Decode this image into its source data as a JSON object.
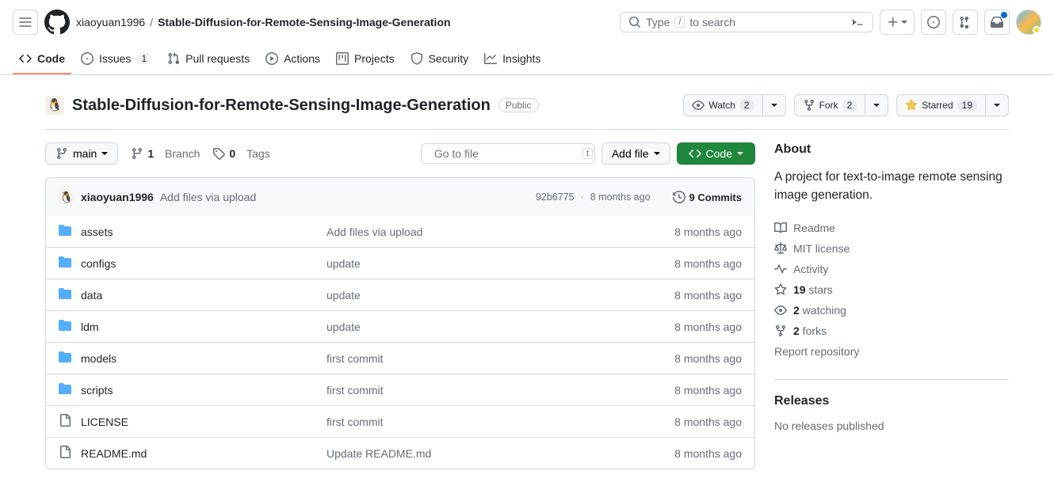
{
  "header": {
    "owner": "xiaoyuan1996",
    "repo": "Stable-Diffusion-for-Remote-Sensing-Image-Generation",
    "searchPlaceholder": "Type / to search",
    "searchPrefix": "Type ",
    "searchSuffix": " to search",
    "slashKey": "/"
  },
  "nav": {
    "code": "Code",
    "issues": "Issues",
    "issuesCount": "1",
    "pulls": "Pull requests",
    "actions": "Actions",
    "projects": "Projects",
    "security": "Security",
    "insights": "Insights"
  },
  "repo": {
    "visibility": "Public",
    "watch": "Watch",
    "watchCount": "2",
    "fork": "Fork",
    "forkCount": "2",
    "starred": "Starred",
    "starCount": "19"
  },
  "toolbar": {
    "branch": "main",
    "branchCount": "1",
    "branchLabel": "Branch",
    "tagCount": "0",
    "tagLabel": "Tags",
    "goToFile": "Go to file",
    "goToFileKey": "t",
    "addFile": "Add file",
    "code": "Code"
  },
  "commit": {
    "author": "xiaoyuan1996",
    "message": "Add files via upload",
    "hash": "92b6775",
    "dotsep": "·",
    "time": "8 months ago",
    "count": "9 Commits"
  },
  "files": [
    {
      "type": "dir",
      "name": "assets",
      "msg": "Add files via upload",
      "time": "8 months ago"
    },
    {
      "type": "dir",
      "name": "configs",
      "msg": "update",
      "time": "8 months ago"
    },
    {
      "type": "dir",
      "name": "data",
      "msg": "update",
      "time": "8 months ago"
    },
    {
      "type": "dir",
      "name": "ldm",
      "msg": "update",
      "time": "8 months ago"
    },
    {
      "type": "dir",
      "name": "models",
      "msg": "first commit",
      "time": "8 months ago"
    },
    {
      "type": "dir",
      "name": "scripts",
      "msg": "first commit",
      "time": "8 months ago"
    },
    {
      "type": "file",
      "name": "LICENSE",
      "msg": "first commit",
      "time": "8 months ago"
    },
    {
      "type": "file",
      "name": "README.md",
      "msg": "Update README.md",
      "time": "8 months ago"
    }
  ],
  "about": {
    "title": "About",
    "desc": "A project for text-to-image remote sensing image generation.",
    "readme": "Readme",
    "license": "MIT license",
    "activity": "Activity",
    "starsCount": "19",
    "starsLabel": " stars",
    "watchCount": "2",
    "watchLabel": " watching",
    "forksCount": "2",
    "forksLabel": " forks",
    "report": "Report repository"
  },
  "releases": {
    "title": "Releases",
    "none": "No releases published"
  }
}
